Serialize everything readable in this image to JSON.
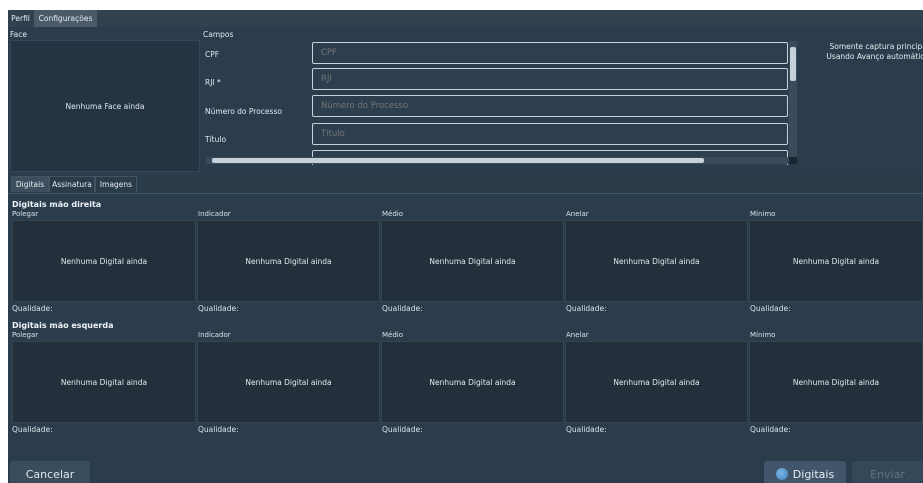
{
  "menu": {
    "tabs": [
      "Perfil",
      "Configurações"
    ],
    "active": "Configurações"
  },
  "face": {
    "label": "Face",
    "placeholder": "Nenhuma Face ainda"
  },
  "fields": {
    "title": "Campos",
    "items": [
      {
        "label": "CPF",
        "placeholder": "CPF"
      },
      {
        "label": "RJI *",
        "placeholder": "RJI"
      },
      {
        "label": "Número do Processo",
        "placeholder": "Número do Processo"
      },
      {
        "label": "Título",
        "placeholder": "Título"
      }
    ]
  },
  "note": {
    "line1": "Somente captura principal",
    "line2": "Usando Avanço automático"
  },
  "tabs": {
    "items": [
      "Digitais",
      "Assinatura",
      "Imagens"
    ],
    "active": "Digitais"
  },
  "right_hand": {
    "title": "Digitais mão direita",
    "fingers": [
      "Polegar",
      "Indicador",
      "Médio",
      "Anelar",
      "Mínimo"
    ]
  },
  "left_hand": {
    "title": "Digitais mão esquerda",
    "fingers": [
      "Polegar",
      "Indicador",
      "Médio",
      "Anelar",
      "Mínimo"
    ]
  },
  "finger_placeholder": "Nenhuma Digital ainda",
  "quality_label": "Qualidade:",
  "buttons": {
    "cancel": "Cancelar",
    "fingerprints": "Digitais",
    "send": "Enviar"
  }
}
